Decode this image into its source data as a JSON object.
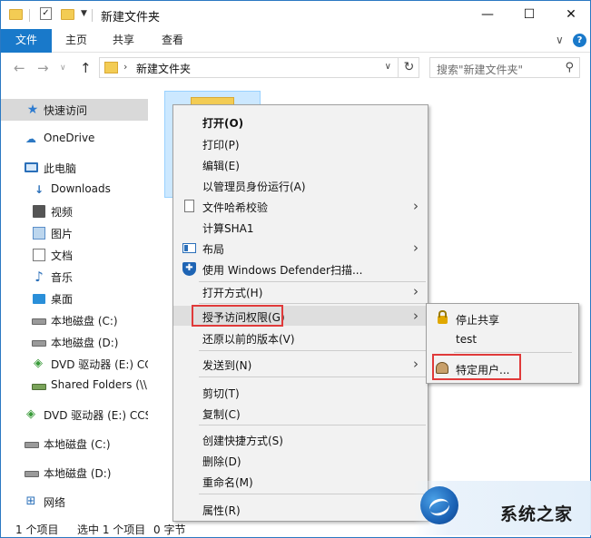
{
  "window": {
    "title": "新建文件夹",
    "controls": {
      "minimize": "—",
      "maximize": "☐",
      "close": "✕"
    }
  },
  "ribbon": {
    "tabs": [
      "文件",
      "主页",
      "共享",
      "查看"
    ],
    "expand_glyph": "∨",
    "help_glyph": "?"
  },
  "address": {
    "path": "新建文件夹",
    "search_placeholder": "搜索\"新建文件夹\""
  },
  "sidebar": {
    "items": [
      {
        "label": "快速访问",
        "icon": "star-icon"
      },
      {
        "label": "OneDrive",
        "icon": "cloud-icon"
      },
      {
        "label": "此电脑",
        "icon": "computer-icon"
      },
      {
        "label": "Downloads",
        "icon": "download-icon"
      },
      {
        "label": "视频",
        "icon": "video-icon"
      },
      {
        "label": "图片",
        "icon": "picture-icon"
      },
      {
        "label": "文档",
        "icon": "document-icon"
      },
      {
        "label": "音乐",
        "icon": "music-icon"
      },
      {
        "label": "桌面",
        "icon": "desktop-icon"
      },
      {
        "label": "本地磁盘 (C:)",
        "icon": "disk-icon"
      },
      {
        "label": "本地磁盘 (D:)",
        "icon": "disk-icon"
      },
      {
        "label": "DVD 驱动器 (E:) CC",
        "icon": "dvd-icon"
      },
      {
        "label": "Shared Folders (\\\\",
        "icon": "network-drive-icon"
      },
      {
        "label": "DVD 驱动器 (E:) CCS",
        "icon": "dvd-icon"
      },
      {
        "label": "本地磁盘 (C:)",
        "icon": "disk-icon"
      },
      {
        "label": "本地磁盘 (D:)",
        "icon": "disk-icon"
      },
      {
        "label": "网络",
        "icon": "network-icon"
      }
    ]
  },
  "status": {
    "item_count": "1 个项目",
    "selected": "选中 1 个项目",
    "size": "0 字节"
  },
  "context_menu": {
    "items": [
      {
        "label": "打开(O)"
      },
      {
        "label": "打印(P)"
      },
      {
        "label": "编辑(E)"
      },
      {
        "label": "以管理员身份运行(A)"
      },
      {
        "label": "文件哈希校验"
      },
      {
        "label": "计算SHA1"
      },
      {
        "label": "布局"
      },
      {
        "label": "使用 Windows Defender扫描..."
      },
      {
        "label": "打开方式(H)"
      },
      {
        "label": "授予访问权限(G)"
      },
      {
        "label": "还原以前的版本(V)"
      },
      {
        "label": "发送到(N)"
      },
      {
        "label": "剪切(T)"
      },
      {
        "label": "复制(C)"
      },
      {
        "label": "创建快捷方式(S)"
      },
      {
        "label": "删除(D)"
      },
      {
        "label": "重命名(M)"
      },
      {
        "label": "属性(R)"
      }
    ],
    "submenu_arrow": "›"
  },
  "submenu": {
    "items": [
      {
        "label": "停止共享"
      },
      {
        "label": "test"
      },
      {
        "label": "特定用户..."
      }
    ]
  },
  "watermark": {
    "text": "系统之家"
  }
}
